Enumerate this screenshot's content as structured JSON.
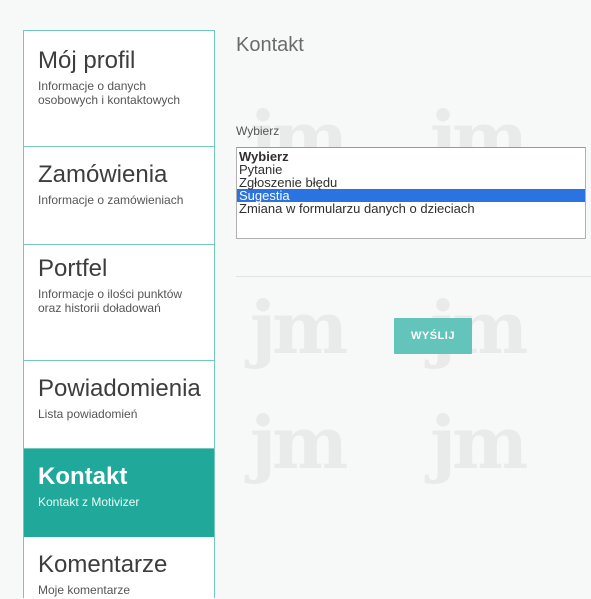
{
  "sidebar": {
    "items": [
      {
        "title": "Mój profil",
        "subtitle": "Informacje o danych osobowych i kontaktowych",
        "active": false
      },
      {
        "title": "Zamówienia",
        "subtitle": "Informacje o zamówieniach",
        "active": false
      },
      {
        "title": "Portfel",
        "subtitle": "Informacje o ilości punktów oraz historii doładowań",
        "active": false
      },
      {
        "title": "Powiadomienia",
        "subtitle": "Lista powiadomień",
        "active": false
      },
      {
        "title": "Kontakt",
        "subtitle": "Kontakt z Motivizer",
        "active": true
      },
      {
        "title": "Komentarze",
        "subtitle": "Moje komentarze",
        "active": false
      }
    ]
  },
  "main": {
    "title": "Kontakt",
    "select_label": "Wybierz",
    "options": [
      "Wybierz",
      "Pytanie",
      "Zgłoszenie błędu",
      "Sugestia",
      "Zmiana w formularzu danych o dzieciach"
    ],
    "selected_option": "Sugestia",
    "submit_label": "WYŚLIJ"
  },
  "colors": {
    "accent": "#20a99b",
    "button": "#62c4ba",
    "selection": "#2b73e0",
    "sidebar_border": "#74c7bd"
  }
}
